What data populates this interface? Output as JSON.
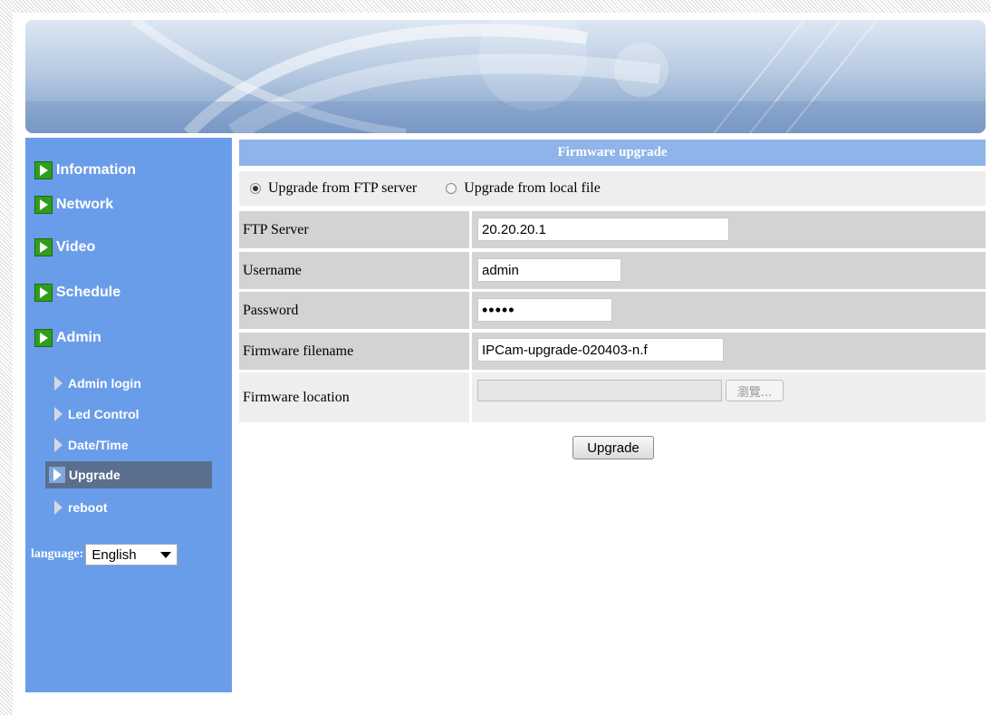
{
  "sidebar": {
    "items": [
      {
        "label": "Information",
        "icon": "play-icon"
      },
      {
        "label": "Network",
        "icon": "play-icon"
      },
      {
        "label": "Video",
        "icon": "play-icon"
      },
      {
        "label": "Schedule",
        "icon": "play-icon"
      },
      {
        "label": "Admin",
        "icon": "play-icon"
      }
    ],
    "subitems": [
      {
        "label": "Admin login",
        "active": false
      },
      {
        "label": "Led Control",
        "active": false
      },
      {
        "label": "Date/Time",
        "active": false
      },
      {
        "label": "Upgrade",
        "active": true
      },
      {
        "label": "reboot",
        "active": false
      }
    ],
    "language": {
      "label": "language:",
      "selected": "English"
    },
    "color": "#6a9de9"
  },
  "panel": {
    "title": "Firmware upgrade",
    "radio_ftp": "Upgrade from FTP server",
    "radio_local": "Upgrade from local file",
    "selected_mode": "ftp",
    "fields": {
      "ftp_server": {
        "label": "FTP Server",
        "value": "20.20.20.1"
      },
      "username": {
        "label": "Username",
        "value": "admin"
      },
      "password": {
        "label": "Password",
        "value": "•••••"
      },
      "filename": {
        "label": "Firmware filename",
        "value": "IPCam-upgrade-020403-n.f"
      },
      "location": {
        "label": "Firmware location",
        "value": "",
        "browse_label": "瀏覽..."
      }
    },
    "submit_label": "Upgrade",
    "header_color": "#8fb4ea"
  }
}
